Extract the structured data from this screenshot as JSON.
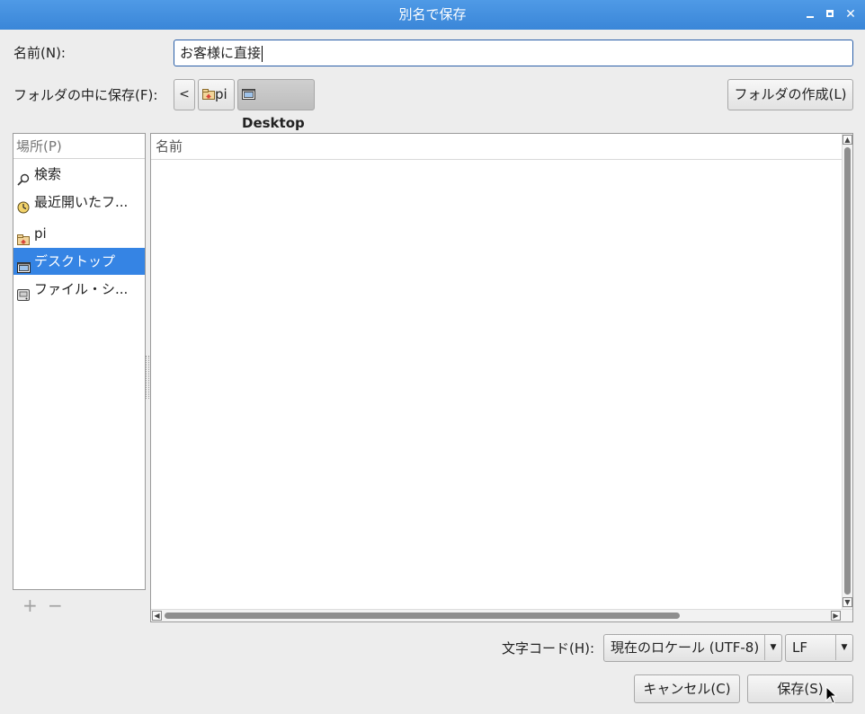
{
  "window": {
    "title": "別名で保存"
  },
  "name_row": {
    "label": "名前(N):",
    "value": "お客様に直接"
  },
  "folder_row": {
    "label": "フォルダの中に保存(F):",
    "crumb_home": "pi",
    "crumb_current": "Desktop",
    "create_folder": "フォルダの作成(L)"
  },
  "places": {
    "header": "場所(P)",
    "items": [
      {
        "label": "検索",
        "icon": "search-icon"
      },
      {
        "label": "最近開いたフ...",
        "icon": "clock-icon"
      },
      {
        "label": "pi",
        "icon": "home-folder-icon"
      },
      {
        "label": "デスクトップ",
        "icon": "desktop-icon",
        "selected": true
      },
      {
        "label": "ファイル・シ...",
        "icon": "drive-icon"
      }
    ],
    "add_symbol": "+",
    "remove_symbol": "−"
  },
  "files": {
    "column_name": "名前"
  },
  "encoding": {
    "label": "文字コード(H):",
    "value": "現在のロケール (UTF-8)",
    "line_ending": "LF"
  },
  "buttons": {
    "cancel": "キャンセル(C)",
    "save": "保存(S)"
  },
  "colors": {
    "titlebar": "#3a86d8",
    "selection": "#3584e4",
    "focus_border": "#2a5fa8"
  }
}
